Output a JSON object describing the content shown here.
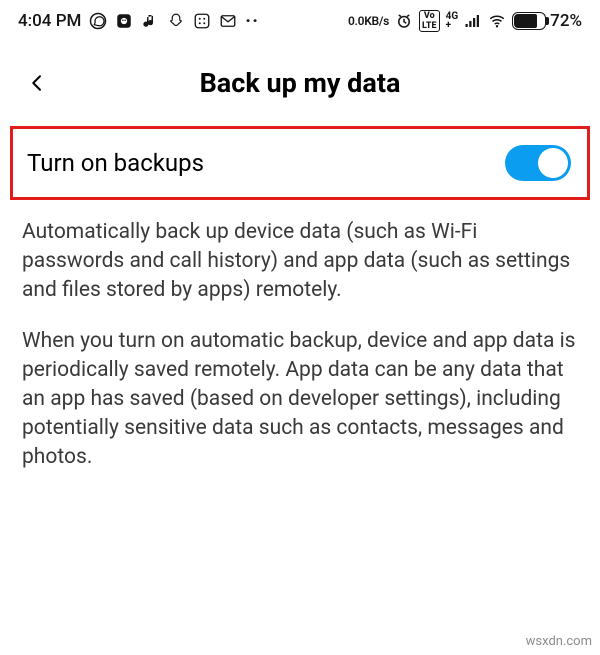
{
  "status": {
    "time": "4:04 PM",
    "dots": "··",
    "speed": "0.0KB/s",
    "volte": "Vo LTE",
    "net_top": "4G",
    "net_bot": "+",
    "battery_pct": "72%"
  },
  "header": {
    "title": "Back up my data"
  },
  "backup": {
    "toggle_label": "Turn on backups"
  },
  "desc": {
    "p1": "Automatically back up device data (such as Wi-Fi passwords and call history) and app data (such as settings and files stored by apps) remotely.",
    "p2": "When you turn on automatic backup, device and app data is periodically saved remotely. App data can be any data that an app has saved (based on developer settings), including potentially sensitive data such as contacts, messages and photos."
  },
  "watermark": "wsxdn.com"
}
